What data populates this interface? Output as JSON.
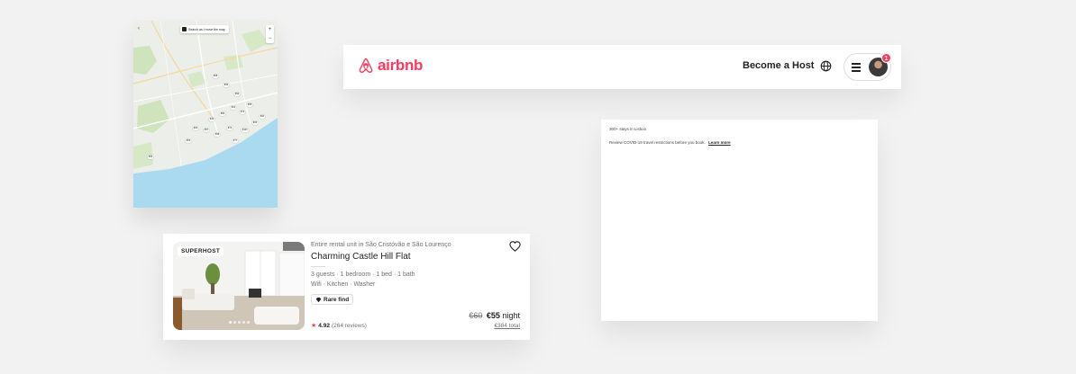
{
  "map": {
    "toggle_label": "Search as I move the map",
    "back_glyph": "‹",
    "zoom_in": "+",
    "zoom_out": "−",
    "price_pins": [
      "€68",
      "€55",
      "€92",
      "€74",
      "€61",
      "€80",
      "€49",
      "€103",
      "€57",
      "€66",
      "€72",
      "€58",
      "€90",
      "€64",
      "€77",
      "€53",
      "€85",
      "€60"
    ]
  },
  "header": {
    "logo_text": "airbnb",
    "become_host": "Become a Host",
    "notification_count": "1",
    "brand_color": "#ff385c"
  },
  "results": {
    "count_text": "300+ stays in Lisbon",
    "covid_text": "Review COVID-19 travel restrictions before you book.",
    "learn_more": "Learn more"
  },
  "listing": {
    "badge": "SUPERHOST",
    "type": "Entire rental unit in São Cristóvão e São Lourenço",
    "title": "Charming Castle Hill Flat",
    "details": "3 guests · 1 bedroom · 1 bed · 1 bath",
    "amenities": "Wifi · Kitchen · Washer",
    "rare_find": "Rare find",
    "rating": "4.92",
    "reviews": "(264 reviews)",
    "old_price": "€60",
    "new_price": "€55",
    "price_unit": "night",
    "total": "€384 total"
  }
}
